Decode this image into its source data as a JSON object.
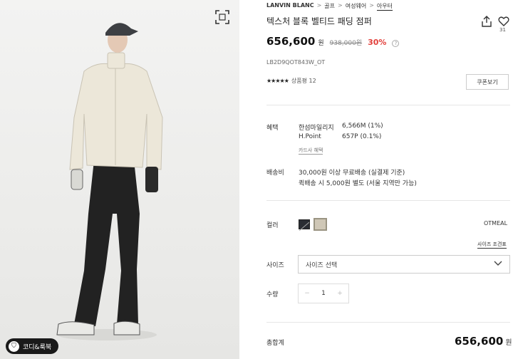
{
  "image": {
    "coordi_button_label": "코디&룩북",
    "icons": {
      "expand": "expand-icon",
      "coordi": "hanger-icon"
    }
  },
  "breadcrumb": [
    "LANVIN BLANC",
    "골프",
    "여성웨어",
    "아우터"
  ],
  "product": {
    "title": "텍스처 블록 벨티드 패딩 점퍼",
    "price": "656,600",
    "price_unit": "원",
    "original_price": "938,000원",
    "discount": "30%",
    "code": "LB2D9QOT843W_OT",
    "rating_stars": "★★★★★",
    "review_label": "상품평 12",
    "likes": "31"
  },
  "coupon_label": "쿠폰보기",
  "benefit": {
    "label": "혜택",
    "rows": [
      {
        "name": "한섬마일리지",
        "value": "6,566M (1%)"
      },
      {
        "name": "H.Point",
        "value": "657P (0.1%)"
      }
    ],
    "card_link": "카드사 혜택"
  },
  "shipping": {
    "label": "배송비",
    "line1": "30,000원 이상 무료배송 (실결제 기준)",
    "line2": "퀵배송 시 5,000원 별도 (서울 지역만 가능)"
  },
  "color": {
    "label": "컬러",
    "selected": "OTMEAL",
    "swatches": [
      "#2a2d33",
      "#cfc7b6"
    ]
  },
  "size_guide": "사이즈 조견표",
  "size": {
    "label": "사이즈",
    "placeholder": "사이즈 선택"
  },
  "quantity": {
    "label": "수량",
    "value": "1",
    "minus": "−",
    "plus": "+"
  },
  "total": {
    "label": "총합계",
    "value": "656,600",
    "unit": "원"
  },
  "accent": "#e2403b"
}
